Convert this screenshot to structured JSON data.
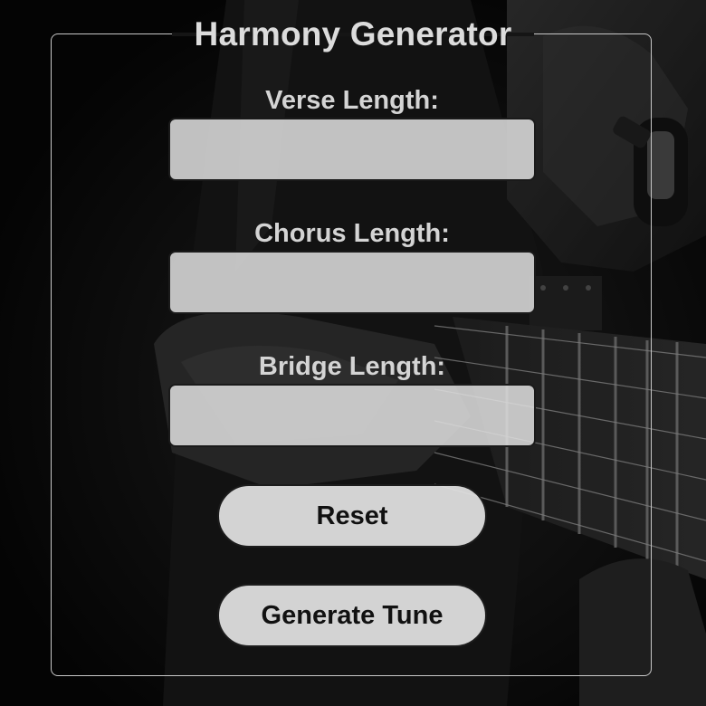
{
  "form": {
    "title": "Harmony Generator",
    "fields": [
      {
        "label": "Verse Length:",
        "value": "",
        "placeholder": ""
      },
      {
        "label": "Chorus Length:",
        "value": "",
        "placeholder": ""
      },
      {
        "label": "Bridge Length:",
        "value": "",
        "placeholder": ""
      }
    ],
    "buttons": {
      "reset_label": "Reset",
      "generate_label": "Generate Tune"
    }
  },
  "colors": {
    "background": "#0b0b0b",
    "panel_border": "#c8c8c8",
    "text_light": "#dcdcdc",
    "input_fill": "#e0e0e0",
    "button_fill": "#e2e2e2",
    "button_text": "#111111"
  },
  "background_image": {
    "icon": "guitarist-photo"
  }
}
